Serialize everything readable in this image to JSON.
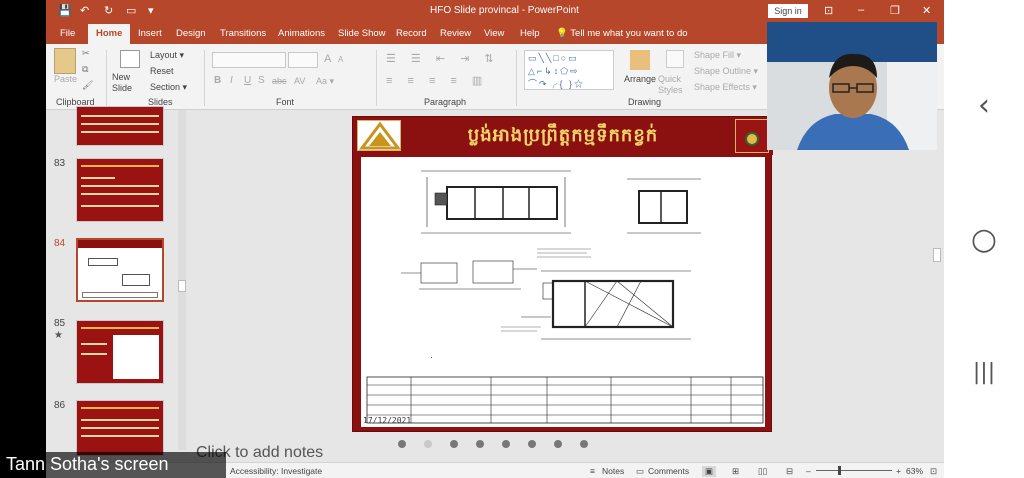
{
  "titlebar": {
    "title": "HFO Slide provincal  -  PowerPoint",
    "signin": "Sign in",
    "qa_save": "💾",
    "qa_undo": "↶",
    "qa_redo": "↻",
    "qa_present": "▭",
    "qa_more": "▾",
    "win_ribbon": "⊡",
    "win_min": "–",
    "win_max": "❐",
    "win_close": "✕"
  },
  "tabs": [
    "File",
    "Home",
    "Insert",
    "Design",
    "Transitions",
    "Animations",
    "Slide Show",
    "Record",
    "Review",
    "View",
    "Help"
  ],
  "tellme": "Tell me what you want to do",
  "ribbon": {
    "clipboard": {
      "paste": "Paste",
      "label": "Clipboard"
    },
    "slides": {
      "new_slide": "New Slide",
      "layout": "Layout ▾",
      "reset": "Reset",
      "section": "Section ▾",
      "label": "Slides"
    },
    "font": {
      "bold": "B",
      "italic": "I",
      "underline": "U",
      "strike": "S",
      "abc": "abc",
      "av": "AV",
      "aa": "Aa ▾",
      "grow": "A",
      "shrink": "A",
      "label": "Font"
    },
    "paragraph": {
      "label": "Paragraph"
    },
    "drawing": {
      "arrange": "Arrange",
      "quick_styles": "Quick Styles",
      "shape_fill": "Shape Fill ▾",
      "shape_outline": "Shape Outline ▾",
      "shape_effects": "Shape Effects ▾",
      "label": "Drawing"
    }
  },
  "thumbnails": [
    {
      "num": "83",
      "star": ""
    },
    {
      "num": "84",
      "star": ""
    },
    {
      "num": "85",
      "star": "★"
    },
    {
      "num": "86",
      "star": ""
    }
  ],
  "slide": {
    "title": "ប្លង់អាងប្រព្រឹត្តកម្មទឹកកខ្វក់",
    "date": "17/12/2021"
  },
  "notes_placeholder": "Click to add notes",
  "statusbar": {
    "accessibility": "Accessibility: Investigate",
    "notes": "Notes",
    "comments": "Comments",
    "zoom": "63%"
  },
  "screen_caption": "Tann Sotha's screen",
  "phone_nav": {
    "back": "‹",
    "home": "○",
    "recent": "|||"
  },
  "colors": {
    "accent": "#b7472a",
    "slide_bg": "#8b1010",
    "slide_title": "#f4d36a"
  }
}
